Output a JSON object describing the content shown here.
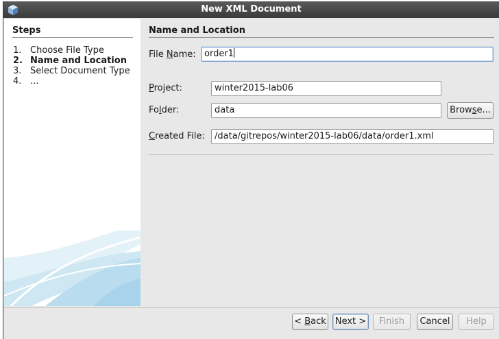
{
  "window": {
    "title": "New XML Document"
  },
  "steps": {
    "heading": "Steps",
    "items": [
      {
        "num": "1.",
        "label": "Choose File Type"
      },
      {
        "num": "2.",
        "label": "Name and Location"
      },
      {
        "num": "3.",
        "label": "Select Document Type"
      },
      {
        "num": "4.",
        "label": "..."
      }
    ],
    "active_index": 1
  },
  "panel": {
    "heading": "Name and Location"
  },
  "form": {
    "file_name": {
      "label_pre": "File ",
      "label_mnemonic": "N",
      "label_post": "ame:",
      "value": "order1"
    },
    "project": {
      "label_mnemonic": "P",
      "label_post": "roject:",
      "value": "winter2015-lab06"
    },
    "folder": {
      "label_pre": "Fo",
      "label_mnemonic": "l",
      "label_post": "der:",
      "value": "data"
    },
    "created_file": {
      "label_mnemonic": "C",
      "label_post": "reated File:",
      "value": "/data/gitrepos/winter2015-lab06/data/order1.xml"
    },
    "browse_pre": "Brow",
    "browse_mnemonic": "s",
    "browse_post": "e..."
  },
  "buttons": {
    "back_pre": "< ",
    "back_mnemonic": "B",
    "back_post": "ack",
    "next": "Next >",
    "finish": "Finish",
    "cancel": "Cancel",
    "help": "Help"
  },
  "colors": {
    "titlebar": "#3b3b3b",
    "dialog_bg": "#e8e8e8",
    "steps_bg": "#ffffff",
    "accent_art": "#bfe0f0"
  }
}
